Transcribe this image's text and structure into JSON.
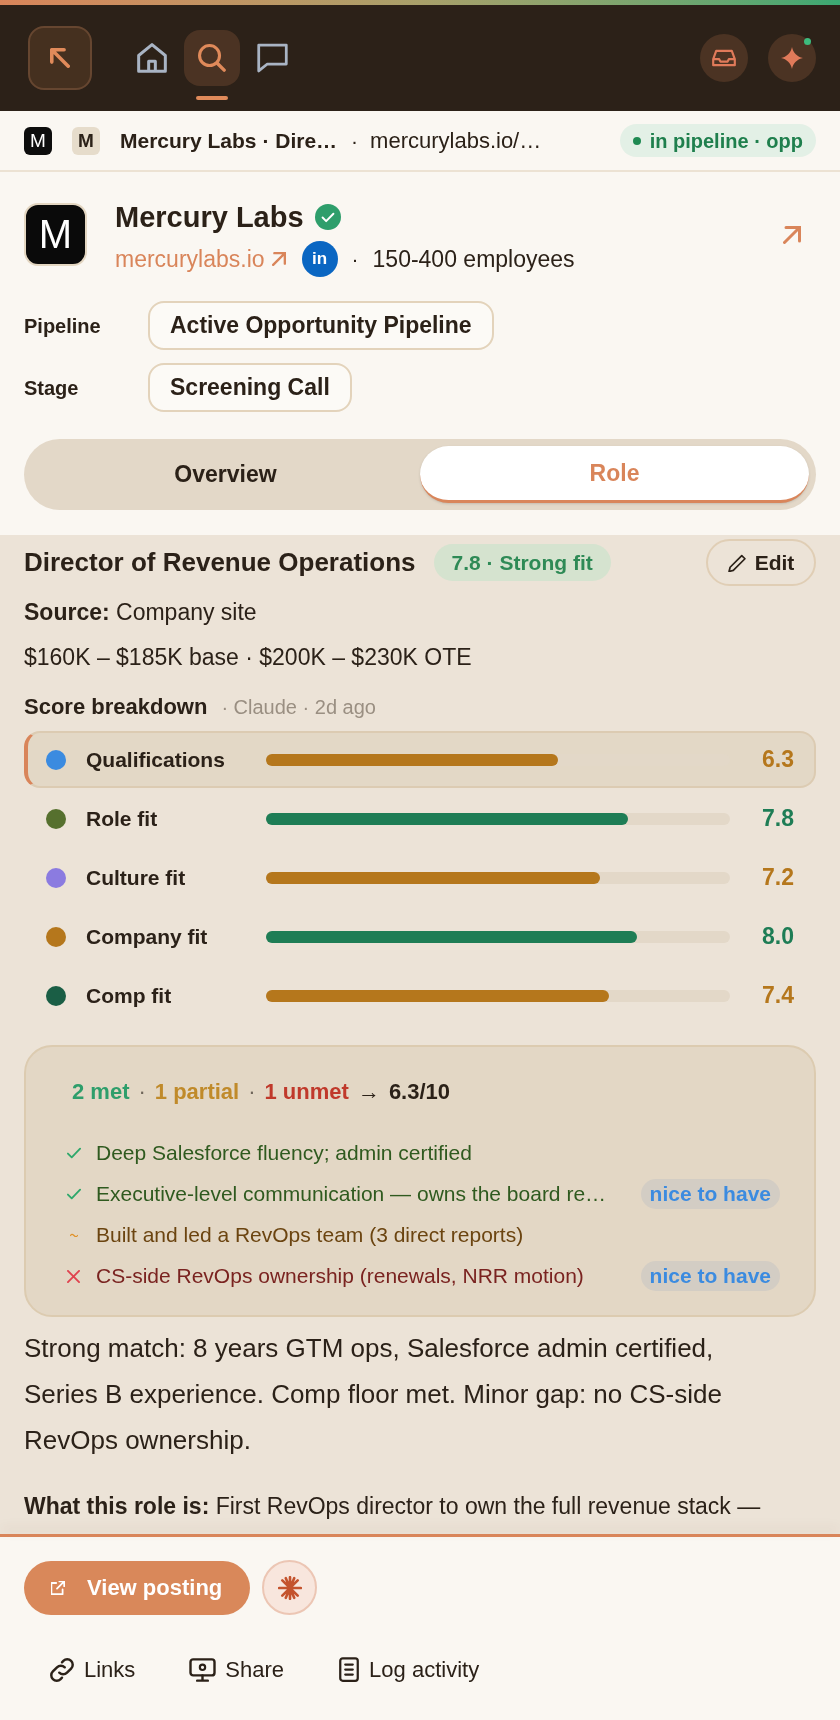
{
  "nav": {
    "items": [
      {
        "kind": "home",
        "selected": false
      },
      {
        "kind": "search",
        "selected": true
      },
      {
        "kind": "chat",
        "selected": false
      }
    ],
    "actions": [
      {
        "kind": "inbox",
        "dot": false
      },
      {
        "kind": "assistant",
        "dot": true
      }
    ]
  },
  "breadcrumb": {
    "favicon": "M",
    "avatar": "M",
    "title": "Mercury Labs · Dire…",
    "separator": "·",
    "url": "mercurylabs.io/…",
    "status": "in pipeline · opp"
  },
  "company": {
    "logo": "M",
    "name": "Mercury Labs",
    "verified": true,
    "website": "mercurylabs.io",
    "social": "in",
    "separator": "·",
    "size": "150-400 employees"
  },
  "fields": [
    {
      "label": "Pipeline",
      "value": "Active Opportunity Pipeline"
    },
    {
      "label": "Stage",
      "value": "Screening Call"
    }
  ],
  "tabs": [
    {
      "label": "Overview",
      "selected": false
    },
    {
      "label": "Role",
      "selected": true
    }
  ],
  "role": {
    "title": "Director of Revenue Operations",
    "fit_badge": "7.8 · Strong fit",
    "edit_button": "Edit",
    "source": "**Source:** Company site",
    "compensation": "$160K – $185K base · $200K – $230K OTE"
  },
  "score_breakdown": {
    "title": "Score breakdown",
    "meta": "· Claude · 2d ago",
    "items": [
      {
        "label": "Qualifications",
        "color": "#3b8be0",
        "level": 0.63,
        "score": "6.3",
        "selected": true
      },
      {
        "label": "Role fit",
        "color": "#56702e",
        "level": 0.78,
        "score": "7.8",
        "selected": false
      },
      {
        "label": "Culture fit",
        "color": "#8b7be0",
        "level": 0.72,
        "score": "7.2",
        "selected": false
      },
      {
        "label": "Company fit",
        "color": "#b5771c",
        "level": 0.8,
        "score": "8.0",
        "selected": false
      },
      {
        "label": "Comp fit",
        "color": "#1a5e45",
        "level": 0.74,
        "score": "7.4",
        "selected": false
      }
    ]
  },
  "requirements": {
    "summary": [
      {
        "kind": "met",
        "text": "2 met"
      },
      {
        "kind": "separator",
        "text": "·"
      },
      {
        "kind": "partial",
        "text": "1 partial"
      },
      {
        "kind": "separator",
        "text": "·"
      },
      {
        "kind": "unmet",
        "text": "1 unmet"
      },
      {
        "kind": "arrow",
        "text": "→"
      },
      {
        "kind": "total",
        "text": "6.3/10"
      }
    ],
    "items": [
      {
        "kind": "met",
        "text": "Deep Salesforce fluency; admin certified"
      },
      {
        "kind": "met",
        "text": "Executive-level communication — owns the board re…",
        "tag": "nice to have"
      },
      {
        "kind": "partial",
        "text": "Built and led a RevOps team (3 direct reports)"
      },
      {
        "kind": "unmet",
        "text": "CS-side RevOps ownership (renewals, NRR motion)",
        "tag": "nice to have"
      }
    ]
  },
  "summary": "Strong match: 8 years GTM ops, Salesforce admin certified, Series B experience. Comp floor met. Minor gap: no CS-side RevOps ownership.",
  "what_this_role_is": "**What this role is:** First RevOps director to own the full revenue stack —",
  "footer": {
    "primary_button": "View posting",
    "links": [
      {
        "kind": "link",
        "label": "Links"
      },
      {
        "kind": "share",
        "label": "Share"
      },
      {
        "kind": "log",
        "label": "Log activity"
      }
    ]
  }
}
